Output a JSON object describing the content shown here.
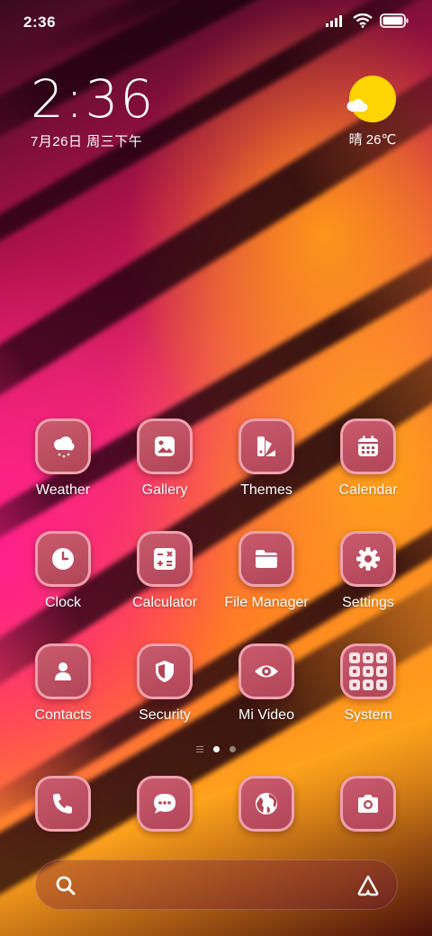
{
  "status_bar": {
    "time": "2:36",
    "icons": [
      "signal-icon",
      "wifi-icon",
      "battery-icon"
    ]
  },
  "clock_widget": {
    "time": "2:36",
    "date": "7月26日 周三下午"
  },
  "weather_widget": {
    "icon": "sun-cloud-icon",
    "text": "晴 26℃",
    "sun_color": "#ffd400"
  },
  "apps": [
    {
      "label": "Weather",
      "icon": "weather-icon"
    },
    {
      "label": "Gallery",
      "icon": "gallery-icon"
    },
    {
      "label": "Themes",
      "icon": "themes-icon"
    },
    {
      "label": "Calendar",
      "icon": "calendar-icon"
    },
    {
      "label": "Clock",
      "icon": "clock-icon"
    },
    {
      "label": "Calculator",
      "icon": "calculator-icon"
    },
    {
      "label": "File Manager",
      "icon": "folder-icon"
    },
    {
      "label": "Settings",
      "icon": "gear-icon"
    },
    {
      "label": "Contacts",
      "icon": "contacts-icon"
    },
    {
      "label": "Security",
      "icon": "shield-icon"
    },
    {
      "label": "Mi Video",
      "icon": "eye-icon"
    },
    {
      "label": "System",
      "icon": "folder-grid-icon"
    }
  ],
  "page_indicator": {
    "pages": 2,
    "active_page": 1
  },
  "dock": [
    {
      "icon": "phone-icon"
    },
    {
      "icon": "messages-icon"
    },
    {
      "icon": "browser-icon"
    },
    {
      "icon": "camera-icon"
    }
  ],
  "search_bar": {
    "left_icon": "search-icon",
    "right_icon": "assistant-icon"
  },
  "colors": {
    "icon_tile": "#b14658",
    "icon_border": "#ffbec8",
    "accent_sun": "#ffd400"
  }
}
